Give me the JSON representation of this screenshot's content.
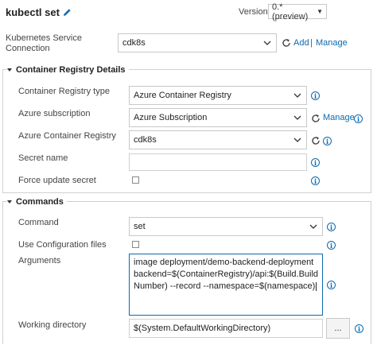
{
  "header": {
    "title": "kubectl set",
    "version_label": "Version",
    "version_value": "0.* (preview)"
  },
  "connection": {
    "label_line1": "Kubernetes Service",
    "label_line2": "Connection",
    "value": "cdk8s",
    "add_label": "Add",
    "separator": "|",
    "manage_label": "Manage"
  },
  "registry_section": {
    "title": "Container Registry Details",
    "registry_type_label": "Container Registry type",
    "registry_type_value": "Azure Container Registry",
    "subscription_label": "Azure subscription",
    "subscription_value": "Azure Subscription",
    "subscription_manage_label": "Manage",
    "acr_label": "Azure Container Registry",
    "acr_value": "cdk8s",
    "secret_label": "Secret name",
    "secret_value": "",
    "force_update_label": "Force update secret"
  },
  "commands_section": {
    "title": "Commands",
    "command_label": "Command",
    "command_value": "set",
    "use_config_label": "Use Configuration files",
    "arguments_label": "Arguments",
    "arguments_line1": "image deployment/demo-backend-deployment",
    "arguments_line2": "backend=$(ContainerRegistry)/api:$(Build.Build",
    "arguments_line3": "Number) --record --namespace=$(namespace)",
    "working_dir_label": "Working directory",
    "working_dir_value": "$(System.DefaultWorkingDirectory)",
    "browse_label": "..."
  },
  "colors": {
    "accent": "#0b6ab0",
    "border": "#d0d0d0"
  }
}
